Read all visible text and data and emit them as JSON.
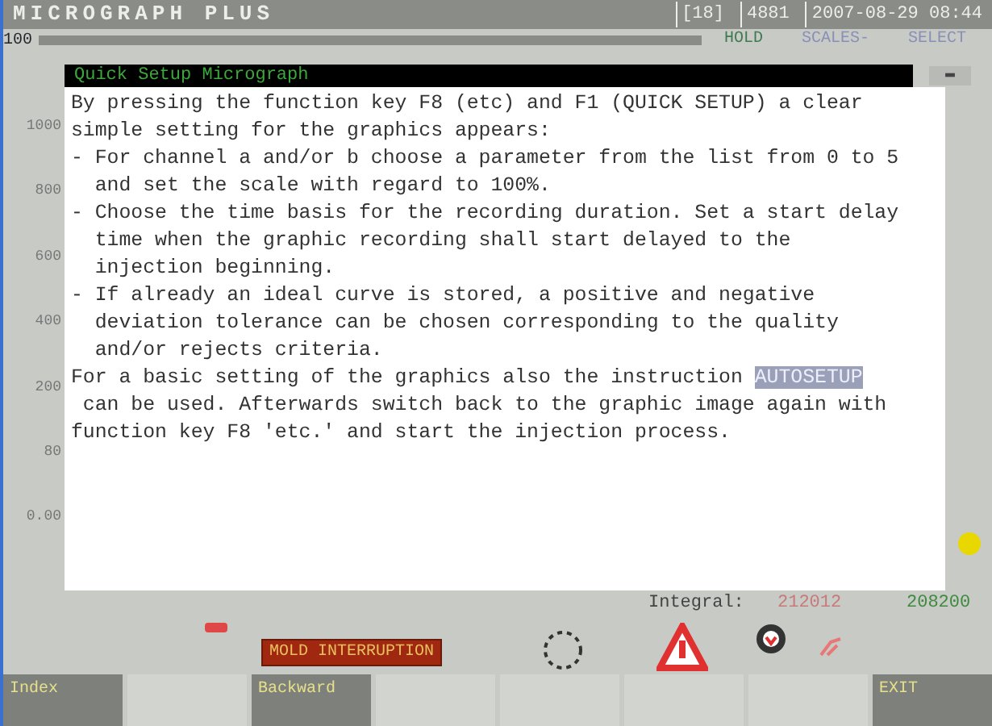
{
  "header": {
    "title": "MICROGRAPH PLUS",
    "fields": [
      "[18]",
      "4881",
      "2007-08-29 08:44"
    ]
  },
  "toolbar": {
    "scale_label": "100",
    "buttons": [
      {
        "label": "HOLD",
        "color": "#3f7a50"
      },
      {
        "label": "SCALES-",
        "color": "#8a8fb8"
      },
      {
        "label": "SELECT",
        "color": "#8a8fb8"
      }
    ]
  },
  "axis_labels": [
    "1000",
    "800",
    "600",
    "400",
    "200",
    "80",
    "0.00"
  ],
  "dialog": {
    "title": "Quick Setup Micrograph",
    "close_label": "▬",
    "paragraphs": [
      {
        "kind": "plain",
        "text": "By pressing the function key F8 (etc) and F1 (QUICK SETUP) a clear\nsimple setting for the graphics appears:"
      },
      {
        "kind": "plain",
        "text": "- For channel a and/or b choose a parameter from the list from 0 to 5\n  and set the scale with regard to 100%."
      },
      {
        "kind": "plain",
        "text": "- Choose the time basis for the recording duration. Set a start delay\n  time when the graphic recording shall start delayed to the\n  injection beginning."
      },
      {
        "kind": "plain",
        "text": "- If already an ideal curve is stored, a positive and negative\n  deviation tolerance can be chosen corresponding to the quality\n  and/or rejects criteria."
      },
      {
        "kind": "keyword",
        "before": "For a basic setting of the graphics also the instruction ",
        "keyword": "AUTOSETUP",
        "after": "\n can be used. Afterwards switch back to the graphic image again with\nfunction key F8 'etc.' and start the injection process."
      }
    ]
  },
  "status": {
    "integral_label": "Integral:",
    "values": [
      {
        "text": "212012",
        "color": "#c87a7a"
      },
      {
        "text": "208200",
        "color": "#3f8a3f"
      }
    ],
    "alarm": "MOLD INTERRUPTION"
  },
  "function_keys": [
    {
      "label": "Index",
      "highlighted": true
    },
    {
      "highlighted": false
    },
    {
      "label": "Backward",
      "highlighted": true
    },
    {
      "highlighted": false
    },
    {
      "highlighted": false
    },
    {
      "highlighted": false
    },
    {
      "highlighted": false
    },
    {
      "label": "EXIT",
      "highlighted": true
    }
  ]
}
